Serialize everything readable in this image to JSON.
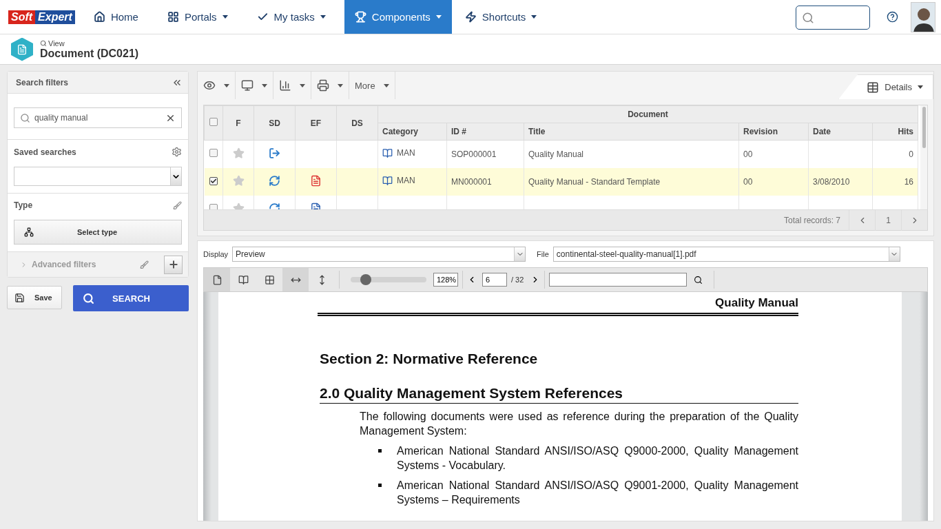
{
  "nav": {
    "items": [
      {
        "label": "Home",
        "selected": false,
        "dropdown": false
      },
      {
        "label": "Portals",
        "selected": false,
        "dropdown": true
      },
      {
        "label": "My tasks",
        "selected": false,
        "dropdown": true
      },
      {
        "label": "Components",
        "selected": true,
        "dropdown": true
      },
      {
        "label": "Shortcuts",
        "selected": false,
        "dropdown": true
      }
    ],
    "logo": [
      "Soft",
      "Expert"
    ]
  },
  "header": {
    "action": "View",
    "title": "Document (DC021)"
  },
  "filters": {
    "title": "Search filters",
    "search_value": "quality manual",
    "saved_searches": "Saved searches",
    "type": "Type",
    "select_type": "Select type",
    "advanced": "Advanced filters",
    "advanced_expanded": false,
    "save": "Save",
    "search": "SEARCH"
  },
  "toolbar": {
    "more": "More",
    "details": "Details"
  },
  "table": {
    "all_selected": false,
    "group": "Document",
    "columns": [
      "F",
      "SD",
      "EF",
      "DS",
      "Category",
      "ID #",
      "Title",
      "Revision",
      "Date",
      "Hits"
    ],
    "rows": [
      {
        "selected": false,
        "favorite": false,
        "status_icon": {
          "kind": "arrow"
        },
        "category": "MAN",
        "id": "SOP000001",
        "title": "Quality Manual",
        "revision": "00",
        "date": "",
        "hits": "0"
      },
      {
        "selected": true,
        "favorite": false,
        "status_icon": {
          "kind": "sync"
        },
        "file_icon": {
          "kind": "pdf"
        },
        "category": "MAN",
        "id": "MN000001",
        "title": "Quality Manual - Standard Template",
        "revision": "00",
        "date": "3/08/2010",
        "hits": "16"
      },
      {
        "selected": false,
        "favorite": false,
        "status_icon": {
          "kind": "sync"
        },
        "file_icon": {
          "kind": "doc"
        }
      }
    ],
    "total": "Total records: 7",
    "page": "1"
  },
  "viewer": {
    "display_label": "Display",
    "display_value": "Preview",
    "file_label": "File",
    "file_value": "continental-steel-quality-manual[1].pdf",
    "tools": [
      {
        "kind": "single",
        "selected": true
      },
      {
        "kind": "double",
        "selected": false
      },
      {
        "kind": "grid",
        "selected": false
      },
      {
        "kind": "width",
        "selected": true
      },
      {
        "kind": "height",
        "selected": false
      }
    ],
    "zoom": {
      "level": 0.2
    },
    "zoom_value": "128%",
    "page": "6",
    "page_total": "/ 32"
  },
  "document": {
    "running_head": "Quality Manual",
    "section": "Section 2: Normative Reference",
    "subsection": "2.0 Quality Management System References",
    "paragraph": "The following documents were used as reference during the preparation of the Quality Management System:",
    "bullets": [
      "American National Standard ANSI/ISO/ASQ Q9000-2000, Quality Management Systems - Vocabulary.",
      "American National Standard ANSI/ISO/ASQ Q9001-2000, Quality Management Systems – Requirements"
    ]
  }
}
